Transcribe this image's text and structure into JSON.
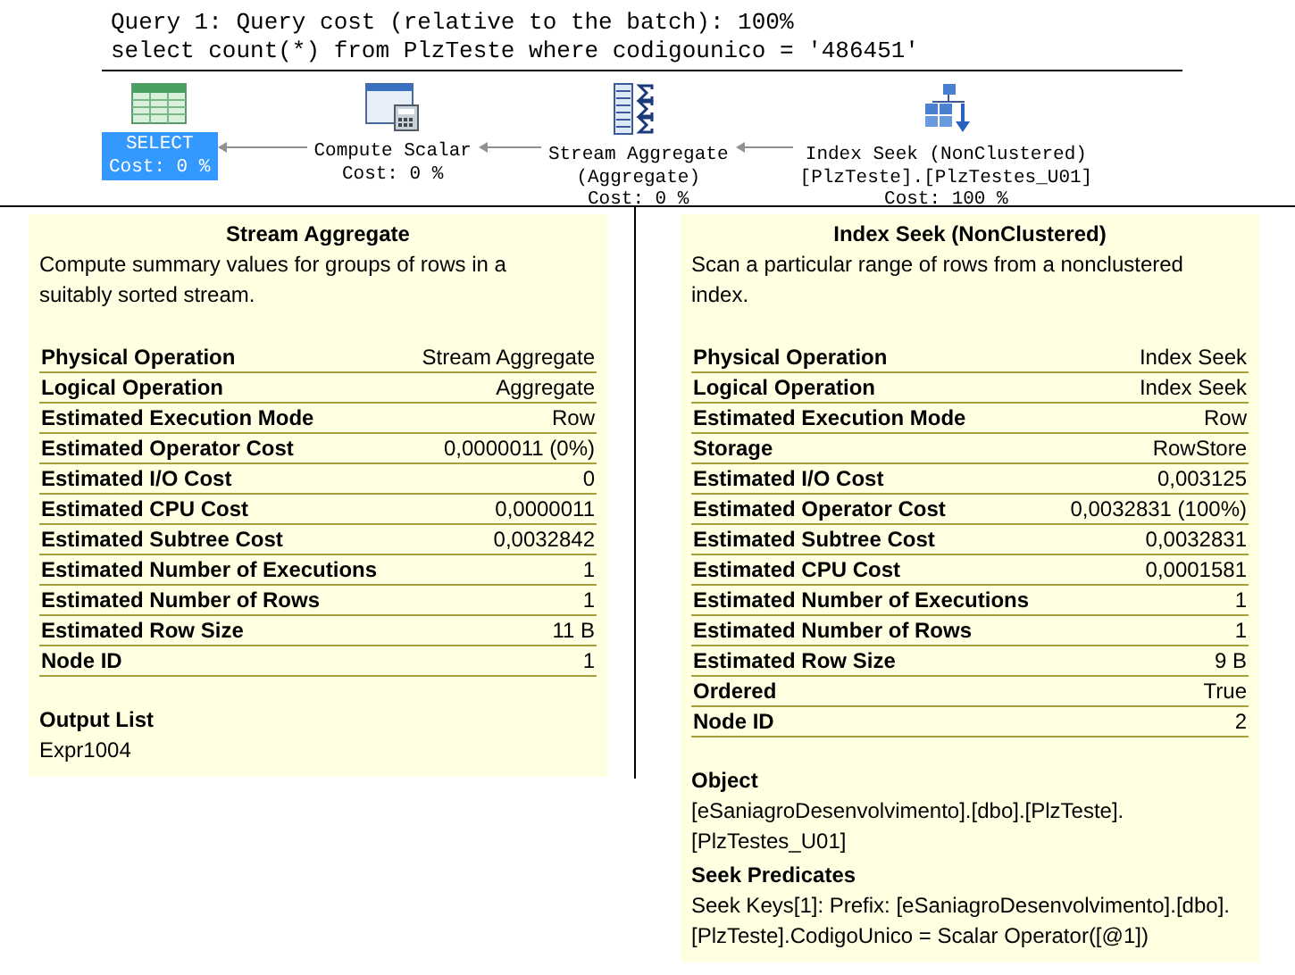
{
  "query": {
    "title": "Query 1: Query cost (relative to the batch): 100%",
    "statement": "select count(*) from PlzTeste where codigounico = '486451'"
  },
  "plan_nodes": [
    {
      "kind": "select",
      "lines": [
        "SELECT"
      ],
      "cost": "Cost: 0 %",
      "selected": true
    },
    {
      "kind": "compute",
      "lines": [
        "Compute Scalar"
      ],
      "cost": "Cost: 0 %",
      "selected": false
    },
    {
      "kind": "aggregate",
      "lines": [
        "Stream Aggregate",
        "(Aggregate)"
      ],
      "cost": "Cost: 0 %",
      "selected": false
    },
    {
      "kind": "seek",
      "lines": [
        "Index Seek (NonClustered)",
        "[PlzTeste].[PlzTestes_U01]"
      ],
      "cost": "Cost: 100 %",
      "selected": false
    }
  ],
  "tooltips": [
    {
      "title": "Stream Aggregate",
      "description": "Compute summary values for groups of rows in a suitably sorted stream.",
      "properties": [
        {
          "label": "Physical Operation",
          "value": "Stream Aggregate"
        },
        {
          "label": "Logical Operation",
          "value": "Aggregate"
        },
        {
          "label": "Estimated Execution Mode",
          "value": "Row"
        },
        {
          "label": "Estimated Operator Cost",
          "value": "0,0000011 (0%)"
        },
        {
          "label": "Estimated I/O Cost",
          "value": "0"
        },
        {
          "label": "Estimated CPU Cost",
          "value": "0,0000011"
        },
        {
          "label": "Estimated Subtree Cost",
          "value": "0,0032842"
        },
        {
          "label": "Estimated Number of Executions",
          "value": "1"
        },
        {
          "label": "Estimated Number of Rows",
          "value": "1"
        },
        {
          "label": "Estimated Row Size",
          "value": "11 B"
        },
        {
          "label": "Node ID",
          "value": "1"
        }
      ],
      "sections": [
        {
          "heading": "Output List",
          "lines": [
            "Expr1004"
          ]
        }
      ]
    },
    {
      "title": "Index Seek (NonClustered)",
      "description": "Scan a particular range of rows from a nonclustered index.",
      "properties": [
        {
          "label": "Physical Operation",
          "value": "Index Seek"
        },
        {
          "label": "Logical Operation",
          "value": "Index Seek"
        },
        {
          "label": "Estimated Execution Mode",
          "value": "Row"
        },
        {
          "label": "Storage",
          "value": "RowStore"
        },
        {
          "label": "Estimated I/O Cost",
          "value": "0,003125"
        },
        {
          "label": "Estimated Operator Cost",
          "value": "0,0032831 (100%)"
        },
        {
          "label": "Estimated Subtree Cost",
          "value": "0,0032831"
        },
        {
          "label": "Estimated CPU Cost",
          "value": "0,0001581"
        },
        {
          "label": "Estimated Number of Executions",
          "value": "1"
        },
        {
          "label": "Estimated Number of Rows",
          "value": "1"
        },
        {
          "label": "Estimated Row Size",
          "value": "9 B"
        },
        {
          "label": "Ordered",
          "value": "True"
        },
        {
          "label": "Node ID",
          "value": "2"
        }
      ],
      "sections": [
        {
          "heading": "Object",
          "lines": [
            "[eSaniagroDesenvolvimento].[dbo].[PlzTeste].",
            "[PlzTestes_U01]"
          ]
        },
        {
          "heading": "Seek Predicates",
          "lines": [
            "Seek Keys[1]: Prefix: [eSaniagroDesenvolvimento].[dbo].",
            "[PlzTeste].CodigoUnico = Scalar Operator([@1])"
          ]
        }
      ]
    }
  ]
}
